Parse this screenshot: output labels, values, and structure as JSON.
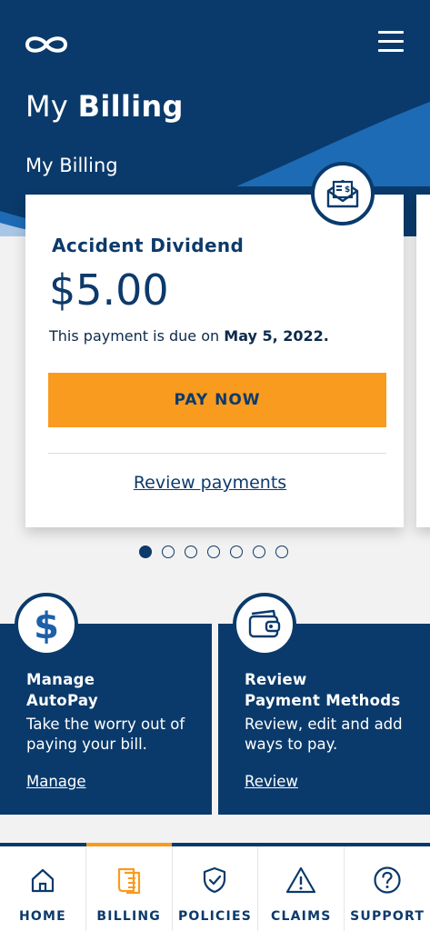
{
  "header": {
    "title_light": "My",
    "title_bold": "Billing",
    "section_label": "My Billing",
    "logo_icon": "infinity-logo-icon",
    "menu_icon": "hamburger-menu-icon"
  },
  "billing_card": {
    "icon": "bill-envelope-icon",
    "title": "Accident Dividend",
    "amount": "$5.00",
    "due_prefix": "This payment is due on",
    "due_date": "May 5, 2022.",
    "pay_button": "PAY NOW",
    "review_link": "Review payments"
  },
  "carousel": {
    "total": 7,
    "active_index": 0
  },
  "tiles": {
    "autopay": {
      "icon": "dollar-icon",
      "title_line1": "Manage",
      "title_line2": "AutoPay",
      "description": "Take the worry out of paying your bill.",
      "link": "Manage"
    },
    "payment_methods": {
      "icon": "wallet-icon",
      "title_line1": "Review",
      "title_line2": "Payment Methods",
      "description": "Review, edit and add ways to pay.",
      "link": "Review"
    }
  },
  "nav": {
    "items": [
      {
        "label": "HOME",
        "icon": "home-icon"
      },
      {
        "label": "BILLING",
        "icon": "billing-document-icon"
      },
      {
        "label": "POLICIES",
        "icon": "shield-check-icon"
      },
      {
        "label": "CLAIMS",
        "icon": "warning-triangle-icon"
      },
      {
        "label": "SUPPORT",
        "icon": "help-circle-icon"
      }
    ],
    "active": "BILLING"
  },
  "colors": {
    "navy": "#0a3a6b",
    "accent_orange": "#f99b1e",
    "wave_blue": "#1d6bb5",
    "background": "#f2f2f2"
  }
}
